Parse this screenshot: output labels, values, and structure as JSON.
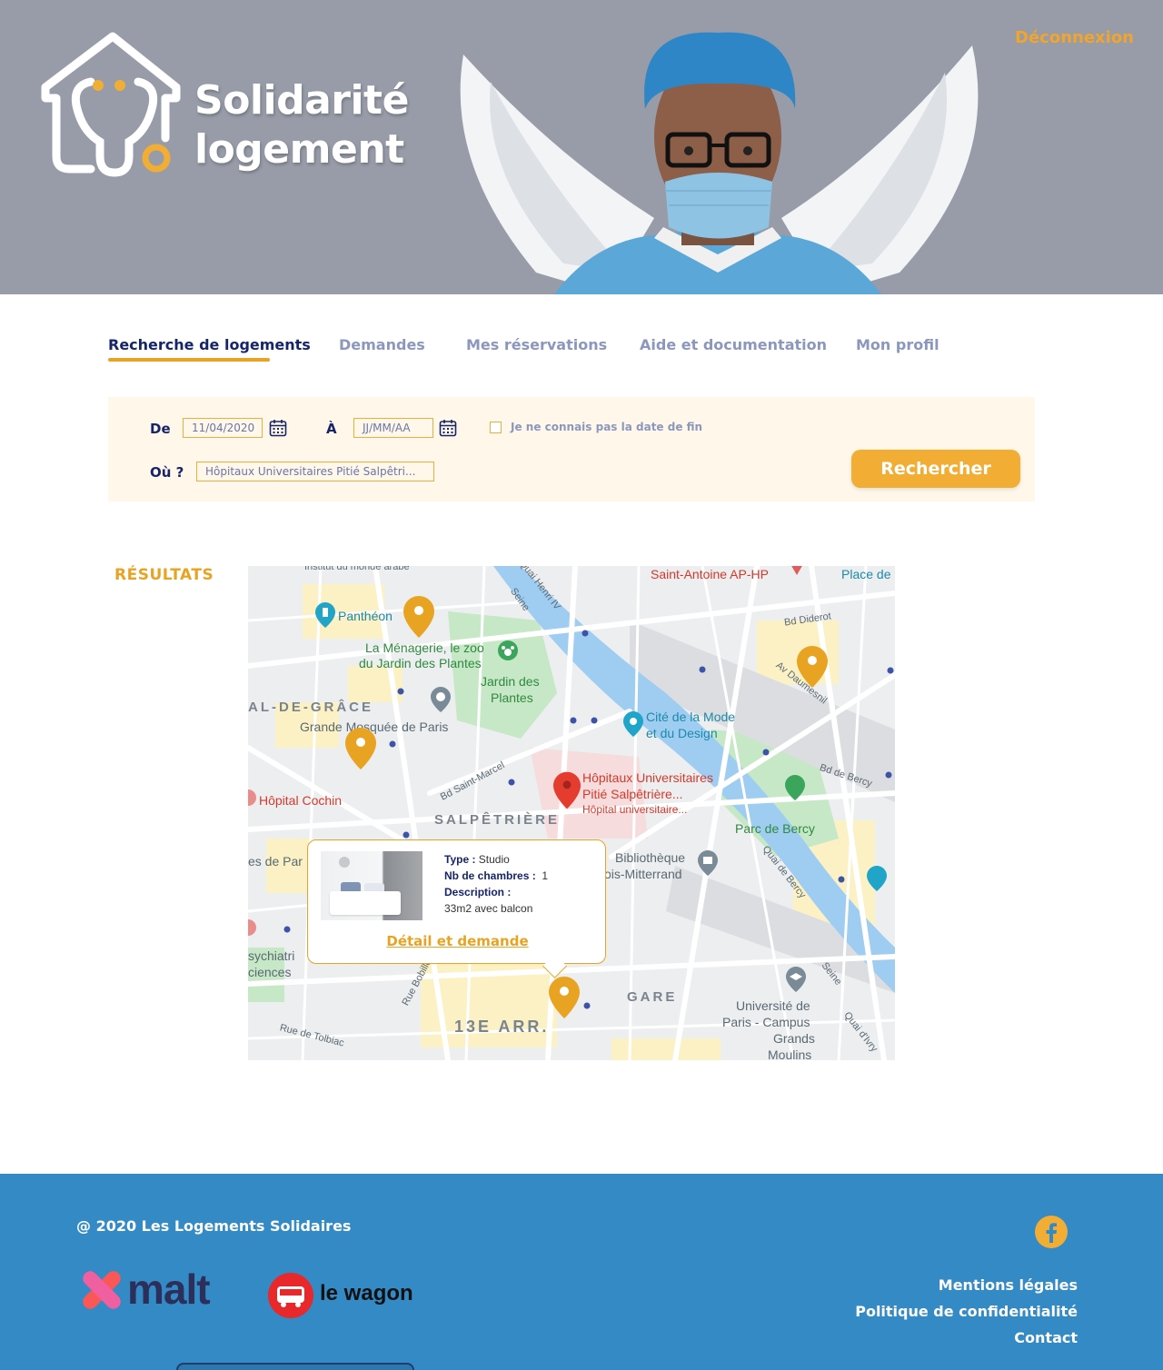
{
  "header": {
    "brand_line1": "Solidarité",
    "brand_line2": "logement",
    "logout": "Déconnexion"
  },
  "nav": {
    "tabs": [
      {
        "label": "Recherche de logements",
        "active": true
      },
      {
        "label": "Demandes",
        "active": false
      },
      {
        "label": "Mes réservations",
        "active": false
      },
      {
        "label": "Aide et documentation",
        "active": false
      },
      {
        "label": "Mon profil",
        "active": false
      }
    ]
  },
  "search": {
    "from_label": "De",
    "from_value": "11/04/2020",
    "to_label": "À",
    "to_placeholder": "JJ/MM/AA",
    "unknown_end_label": "Je ne connais pas la date de fin",
    "unknown_end_checked": false,
    "where_label": "Où ?",
    "where_value": "Hôpitaux Universitaires Pitié Salpêtri...",
    "submit": "Rechercher"
  },
  "results": {
    "title": "RÉSULTATS",
    "map": {
      "labels": {
        "pantheon": "Panthéon",
        "menagerie1": "La Ménagerie, le zoo",
        "menagerie2": "du Jardin des Plantes",
        "jardin1": "Jardin des",
        "jardin2": "Plantes",
        "valdegrace": "AL-DE-GRÂCE",
        "mosquee": "Grande Mosquée de Paris",
        "cochin": "Hôpital Cochin",
        "salpetriere": "SALPÊTRIÈRE",
        "hopital1": "Hôpitaux Universitaires",
        "hopital2": "Pitié Salpêtrière...",
        "hopital3": "Hôpital universitaire...",
        "cite1": "Cité de la Mode",
        "cite2": "et du Design",
        "parc_bercy": "Parc de Bercy",
        "biblio1": "Bibliothèque",
        "biblio2": "ois-Mitterrand",
        "gare": "GARE",
        "arr13": "13E ARR.",
        "univ1": "Université de",
        "univ2": "Paris - Campus",
        "univ3": "Grands",
        "univ4": "Moulins",
        "saint_antoine": "Saint-Antoine AP-HP",
        "place": "Place de",
        "seine1": "Seine",
        "seine2": "Seine",
        "quai_henri": "Quai Henri IV",
        "bd_diderot": "Bd Diderot",
        "av_daumesnil": "Av Daumesnil",
        "bd_bercy": "Bd de Bercy",
        "quai_bercy": "Quai de Bercy",
        "quai_ivry": "Quai d'Ivry",
        "bd_st_marcel": "Bd Saint-Marcel",
        "rue_bobillot": "Rue Bobillot",
        "rue_tolbiac": "Rue de Tolbiac",
        "institut": "Institut du monde arabe",
        "es_de_par": "es de Par",
        "psychiatrie": "sychiatri",
        "sciences": "ciences"
      },
      "popup": {
        "type_label": "Type :",
        "type_value": "Studio",
        "rooms_label": "Nb de chambres :",
        "rooms_value": "1",
        "desc_label": "Description :",
        "desc_value": "33m2 avec balcon",
        "link": "Détail et demande"
      }
    }
  },
  "footer": {
    "copyright": "@ 2020 Les Logements Solidaires",
    "partner1": "malt",
    "partner2": "le wagon",
    "links": [
      "Mentions légales",
      "Politique de confidentialité",
      "Contact"
    ]
  },
  "colors": {
    "accent": "#e8a323",
    "navy": "#162569",
    "header_bg": "#979ca8",
    "footer_bg": "#338ac4",
    "panel_bg": "#fff7e9"
  }
}
